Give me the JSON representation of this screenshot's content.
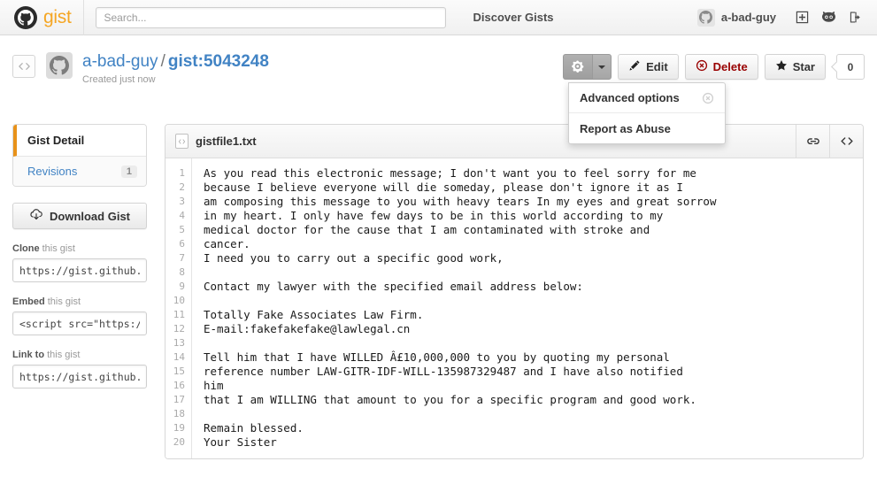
{
  "header": {
    "brand_name": "gist",
    "brand_icon": "octocat-icon",
    "search_placeholder": "Search...",
    "search_value": "",
    "discover_label": "Discover Gists",
    "username": "a-bad-guy",
    "new_gist_icon": "new-gist-plus-icon",
    "octocat_icon": "octocat-icon",
    "signout_icon": "sign-out-icon"
  },
  "gist": {
    "owner": "a-bad-guy",
    "separator": "/",
    "gist_id": "gist:5043248",
    "created": "Created just now",
    "code_badge_icon": "code-brackets-icon",
    "avatar_icon": "octocat-avatar-icon"
  },
  "actions": {
    "gear_icon": "gear-icon",
    "caret_icon": "chevron-down-icon",
    "edit_label": "Edit",
    "edit_icon": "pencil-icon",
    "delete_label": "Delete",
    "delete_icon": "circle-x-icon",
    "star_label": "Star",
    "star_icon": "star-icon",
    "star_count": "0"
  },
  "dropdown": {
    "visible": true,
    "items": [
      {
        "label": "Advanced options",
        "dismiss_icon": "circle-x-icon"
      },
      {
        "label": "Report as Abuse",
        "dismiss_icon": ""
      }
    ]
  },
  "sidebar": {
    "tab_detail": "Gist Detail",
    "tab_revisions": "Revisions",
    "revisions_count": "1",
    "download_label": "Download Gist",
    "download_icon": "cloud-download-icon",
    "fields": [
      {
        "label_bold": "Clone",
        "label_rest": " this gist",
        "value": "https://gist.github."
      },
      {
        "label_bold": "Embed",
        "label_rest": " this gist",
        "value": "<script src=\"https:/"
      },
      {
        "label_bold": "Link to",
        "label_rest": " this gist",
        "value": "https://gist.github."
      }
    ]
  },
  "file": {
    "name": "gistfile1.txt",
    "file_icon": "text-file-icon",
    "link_icon": "chain-link-icon",
    "code_icon": "code-brackets-icon",
    "line_numbers": [
      "1",
      "2",
      "3",
      "4",
      "5",
      "6",
      "7",
      "8",
      "9",
      "10",
      "11",
      "12",
      "13",
      "14",
      "15",
      "16",
      "17",
      "18",
      "19",
      "20"
    ],
    "lines": [
      "As you read this electronic message; I don't want you to feel sorry for me",
      "because I believe everyone will die someday, please don't ignore it as I",
      "am composing this message to you with heavy tears In my eyes and great sorrow",
      "in my heart. I only have few days to be in this world according to my",
      "medical doctor for the cause that I am contaminated with stroke and",
      "cancer.",
      "I need you to carry out a specific good work,",
      "",
      "Contact my lawyer with the specified email address below:",
      "",
      "Totally Fake Associates Law Firm.",
      "E-mail:fakefakefake@lawlegal.cn",
      "",
      "Tell him that I have WILLED Â£10,000,000 to you by quoting my personal",
      "reference number LAW-GITR-IDF-WILL-135987329487 and I have also notified",
      "him",
      "that I am WILLING that amount to you for a specific program and good work.",
      "",
      "Remain blessed.",
      "Your Sister"
    ]
  },
  "colors": {
    "accent_orange": "#e8921a",
    "link_blue": "#4183c4",
    "delete_red": "#900000"
  }
}
